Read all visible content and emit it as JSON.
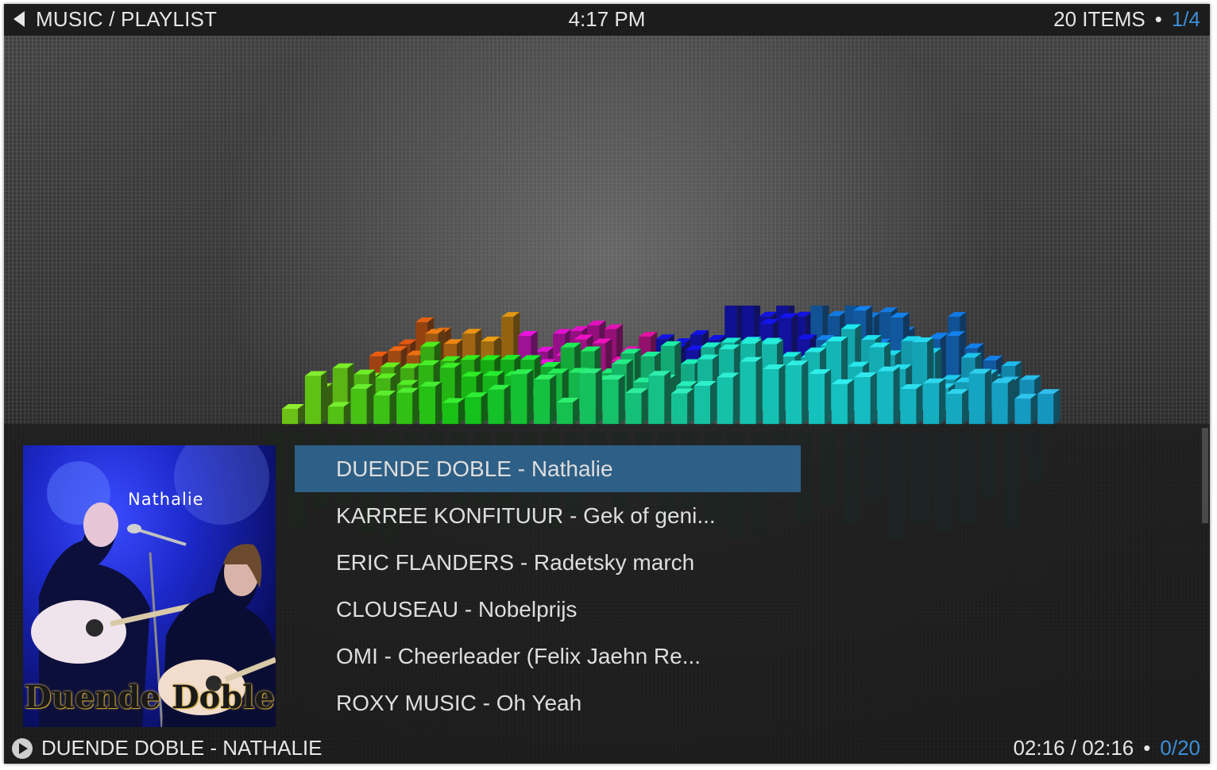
{
  "header": {
    "breadcrumb": "MUSIC / PLAYLIST",
    "clock": "4:17 PM",
    "items_count": "20 ITEMS",
    "separator": "•",
    "page": "1/4"
  },
  "cover": {
    "caption": "Nathalie",
    "title": "Duende Doble"
  },
  "playlist": {
    "items": [
      {
        "label": "DUENDE DOBLE - Nathalie"
      },
      {
        "label": "KARREE KONFITUUR - Gek of geni..."
      },
      {
        "label": "ERIC FLANDERS - Radetsky march"
      },
      {
        "label": "CLOUSEAU - Nobelprijs"
      },
      {
        "label": "OMI - Cheerleader (Felix Jaehn Re..."
      },
      {
        "label": "ROXY MUSIC - Oh Yeah"
      }
    ],
    "selected_index": 0
  },
  "now_playing": {
    "title": "DUENDE DOBLE - NATHALIE",
    "time": "02:16 / 02:16",
    "separator": "•",
    "position": "0/20"
  },
  "colors": {
    "accent": "#3d8ed8",
    "selection": "#2e5f86",
    "text": "#e6e6e6"
  }
}
